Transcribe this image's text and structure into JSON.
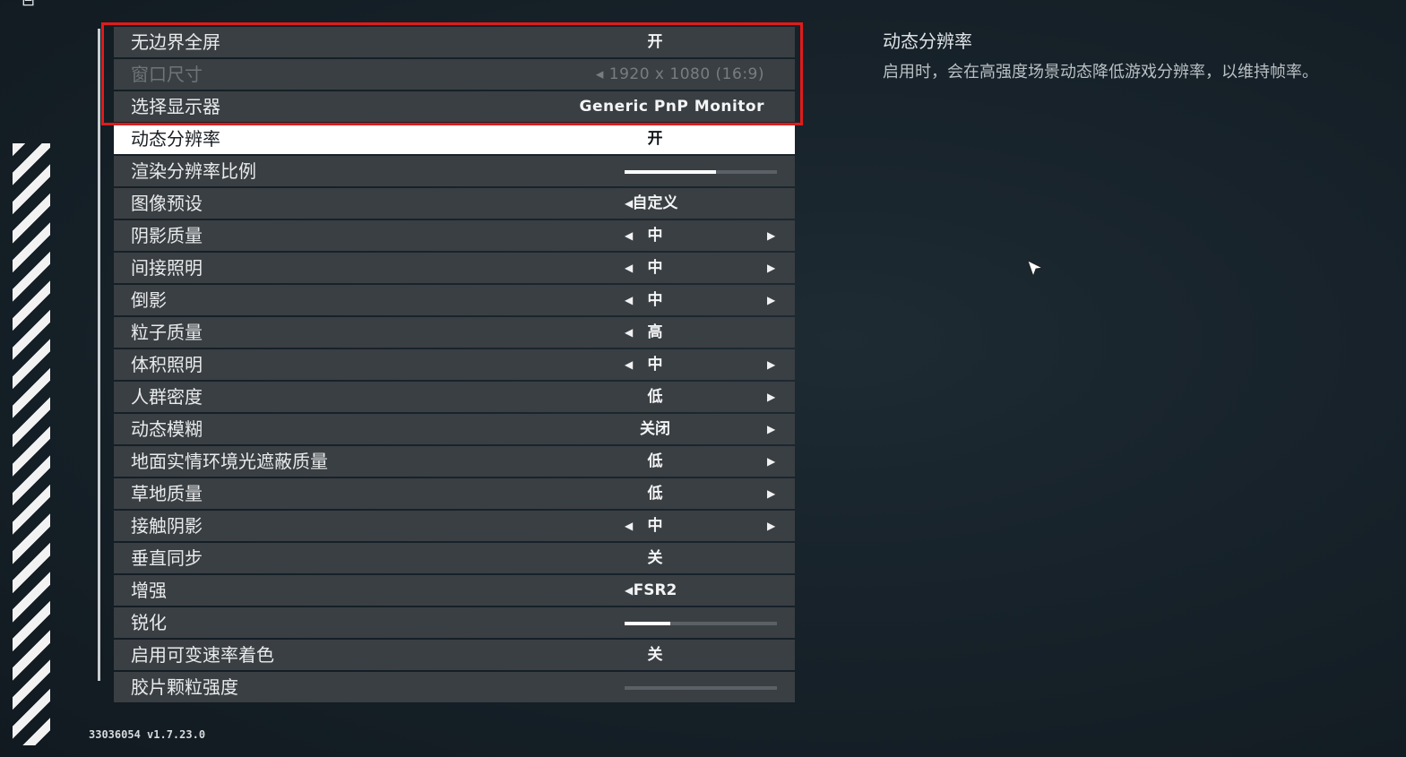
{
  "settings": {
    "rows": [
      {
        "label": "无边界全屏",
        "value": "开"
      },
      {
        "label": "窗口尺寸",
        "value": "1920 x 1080 (16:9)"
      },
      {
        "label": "选择显示器",
        "value": "Generic PnP Monitor"
      },
      {
        "label": "动态分辨率",
        "value": "开"
      },
      {
        "label": "渲染分辨率比例",
        "slider_fraction": 0.6
      },
      {
        "label": "图像预设",
        "value": "自定义"
      },
      {
        "label": "阴影质量",
        "value": "中"
      },
      {
        "label": "间接照明",
        "value": "中"
      },
      {
        "label": "倒影",
        "value": "中"
      },
      {
        "label": "粒子质量",
        "value": "高"
      },
      {
        "label": "体积照明",
        "value": "中"
      },
      {
        "label": "人群密度",
        "value": "低"
      },
      {
        "label": "动态模糊",
        "value": "关闭"
      },
      {
        "label": "地面实情环境光遮蔽质量",
        "value": "低"
      },
      {
        "label": "草地质量",
        "value": "低"
      },
      {
        "label": "接触阴影",
        "value": "中"
      },
      {
        "label": "垂直同步",
        "value": "关"
      },
      {
        "label": "增强",
        "value": "FSR2"
      },
      {
        "label": "锐化",
        "slider_fraction": 0.3
      },
      {
        "label": "启用可变速率着色",
        "value": "关"
      },
      {
        "label": "胶片颗粒强度",
        "slider_fraction": 0.0
      }
    ]
  },
  "info": {
    "title": "动态分辨率",
    "description": "启用时，会在高强度场景动态降低游戏分辨率，以维持帧率。"
  },
  "footer": {
    "version": "33036054 v1.7.23.0"
  },
  "colors": {
    "highlight_box": "#e01b1b",
    "row_background": "#3a3f43",
    "selected_row": "#ffffff"
  }
}
